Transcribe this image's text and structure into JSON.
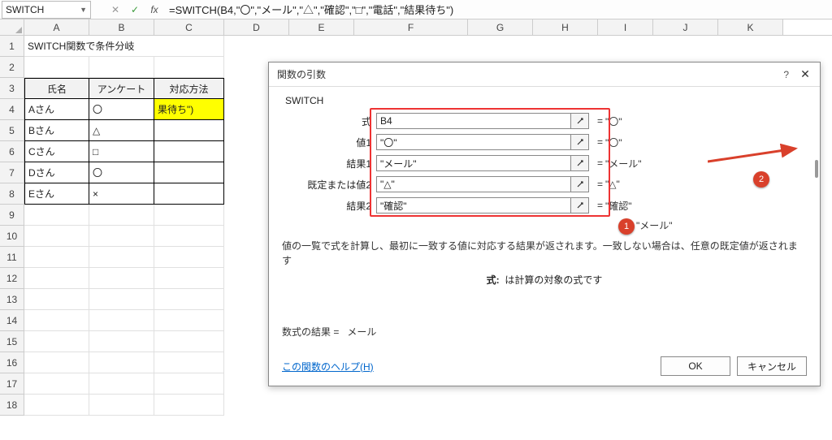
{
  "name_box": "SWITCH",
  "formula": "=SWITCH(B4,\"〇\",\"メール\",\"△\",\"確認\",\"□\",\"電話\",\"結果待ち\")",
  "columns": [
    "A",
    "B",
    "C",
    "D",
    "E",
    "F",
    "G",
    "H",
    "I",
    "J",
    "K"
  ],
  "rows_count": 18,
  "sheet": {
    "title": "SWITCH関数で条件分岐",
    "headers": [
      "氏名",
      "アンケート",
      "対応方法"
    ],
    "data": [
      {
        "name": "Aさん",
        "ans": "〇",
        "method": "果待ち\")"
      },
      {
        "name": "Bさん",
        "ans": "△",
        "method": ""
      },
      {
        "name": "Cさん",
        "ans": "□",
        "method": ""
      },
      {
        "name": "Dさん",
        "ans": "〇",
        "method": ""
      },
      {
        "name": "Eさん",
        "ans": "×",
        "method": ""
      }
    ]
  },
  "dialog": {
    "title": "関数の引数",
    "help_icon": "?",
    "func": "SWITCH",
    "args": [
      {
        "label": "式",
        "value": "B4",
        "eval": "\"〇\""
      },
      {
        "label": "値1",
        "value": "\"〇\"",
        "eval": "\"〇\""
      },
      {
        "label": "結果1",
        "value": "\"メール\"",
        "eval": "\"メール\""
      },
      {
        "label": "既定または値2",
        "value": "\"△\"",
        "eval": "\"△\""
      },
      {
        "label": "結果2",
        "value": "\"確認\"",
        "eval": "\"確認\""
      }
    ],
    "func_result": "\"メール\"",
    "description": "値の一覧で式を計算し、最初に一致する値に対応する結果が返されます。一致しない場合は、任意の既定値が返されます",
    "arg_desc_label": "式:",
    "arg_desc": "は計算の対象の式です",
    "formula_result_label": "数式の結果 =",
    "formula_result": "メール",
    "help_link": "この関数のヘルプ(H)",
    "ok": "OK",
    "cancel": "キャンセル"
  },
  "annotations": {
    "n1": "1",
    "n2": "2"
  }
}
